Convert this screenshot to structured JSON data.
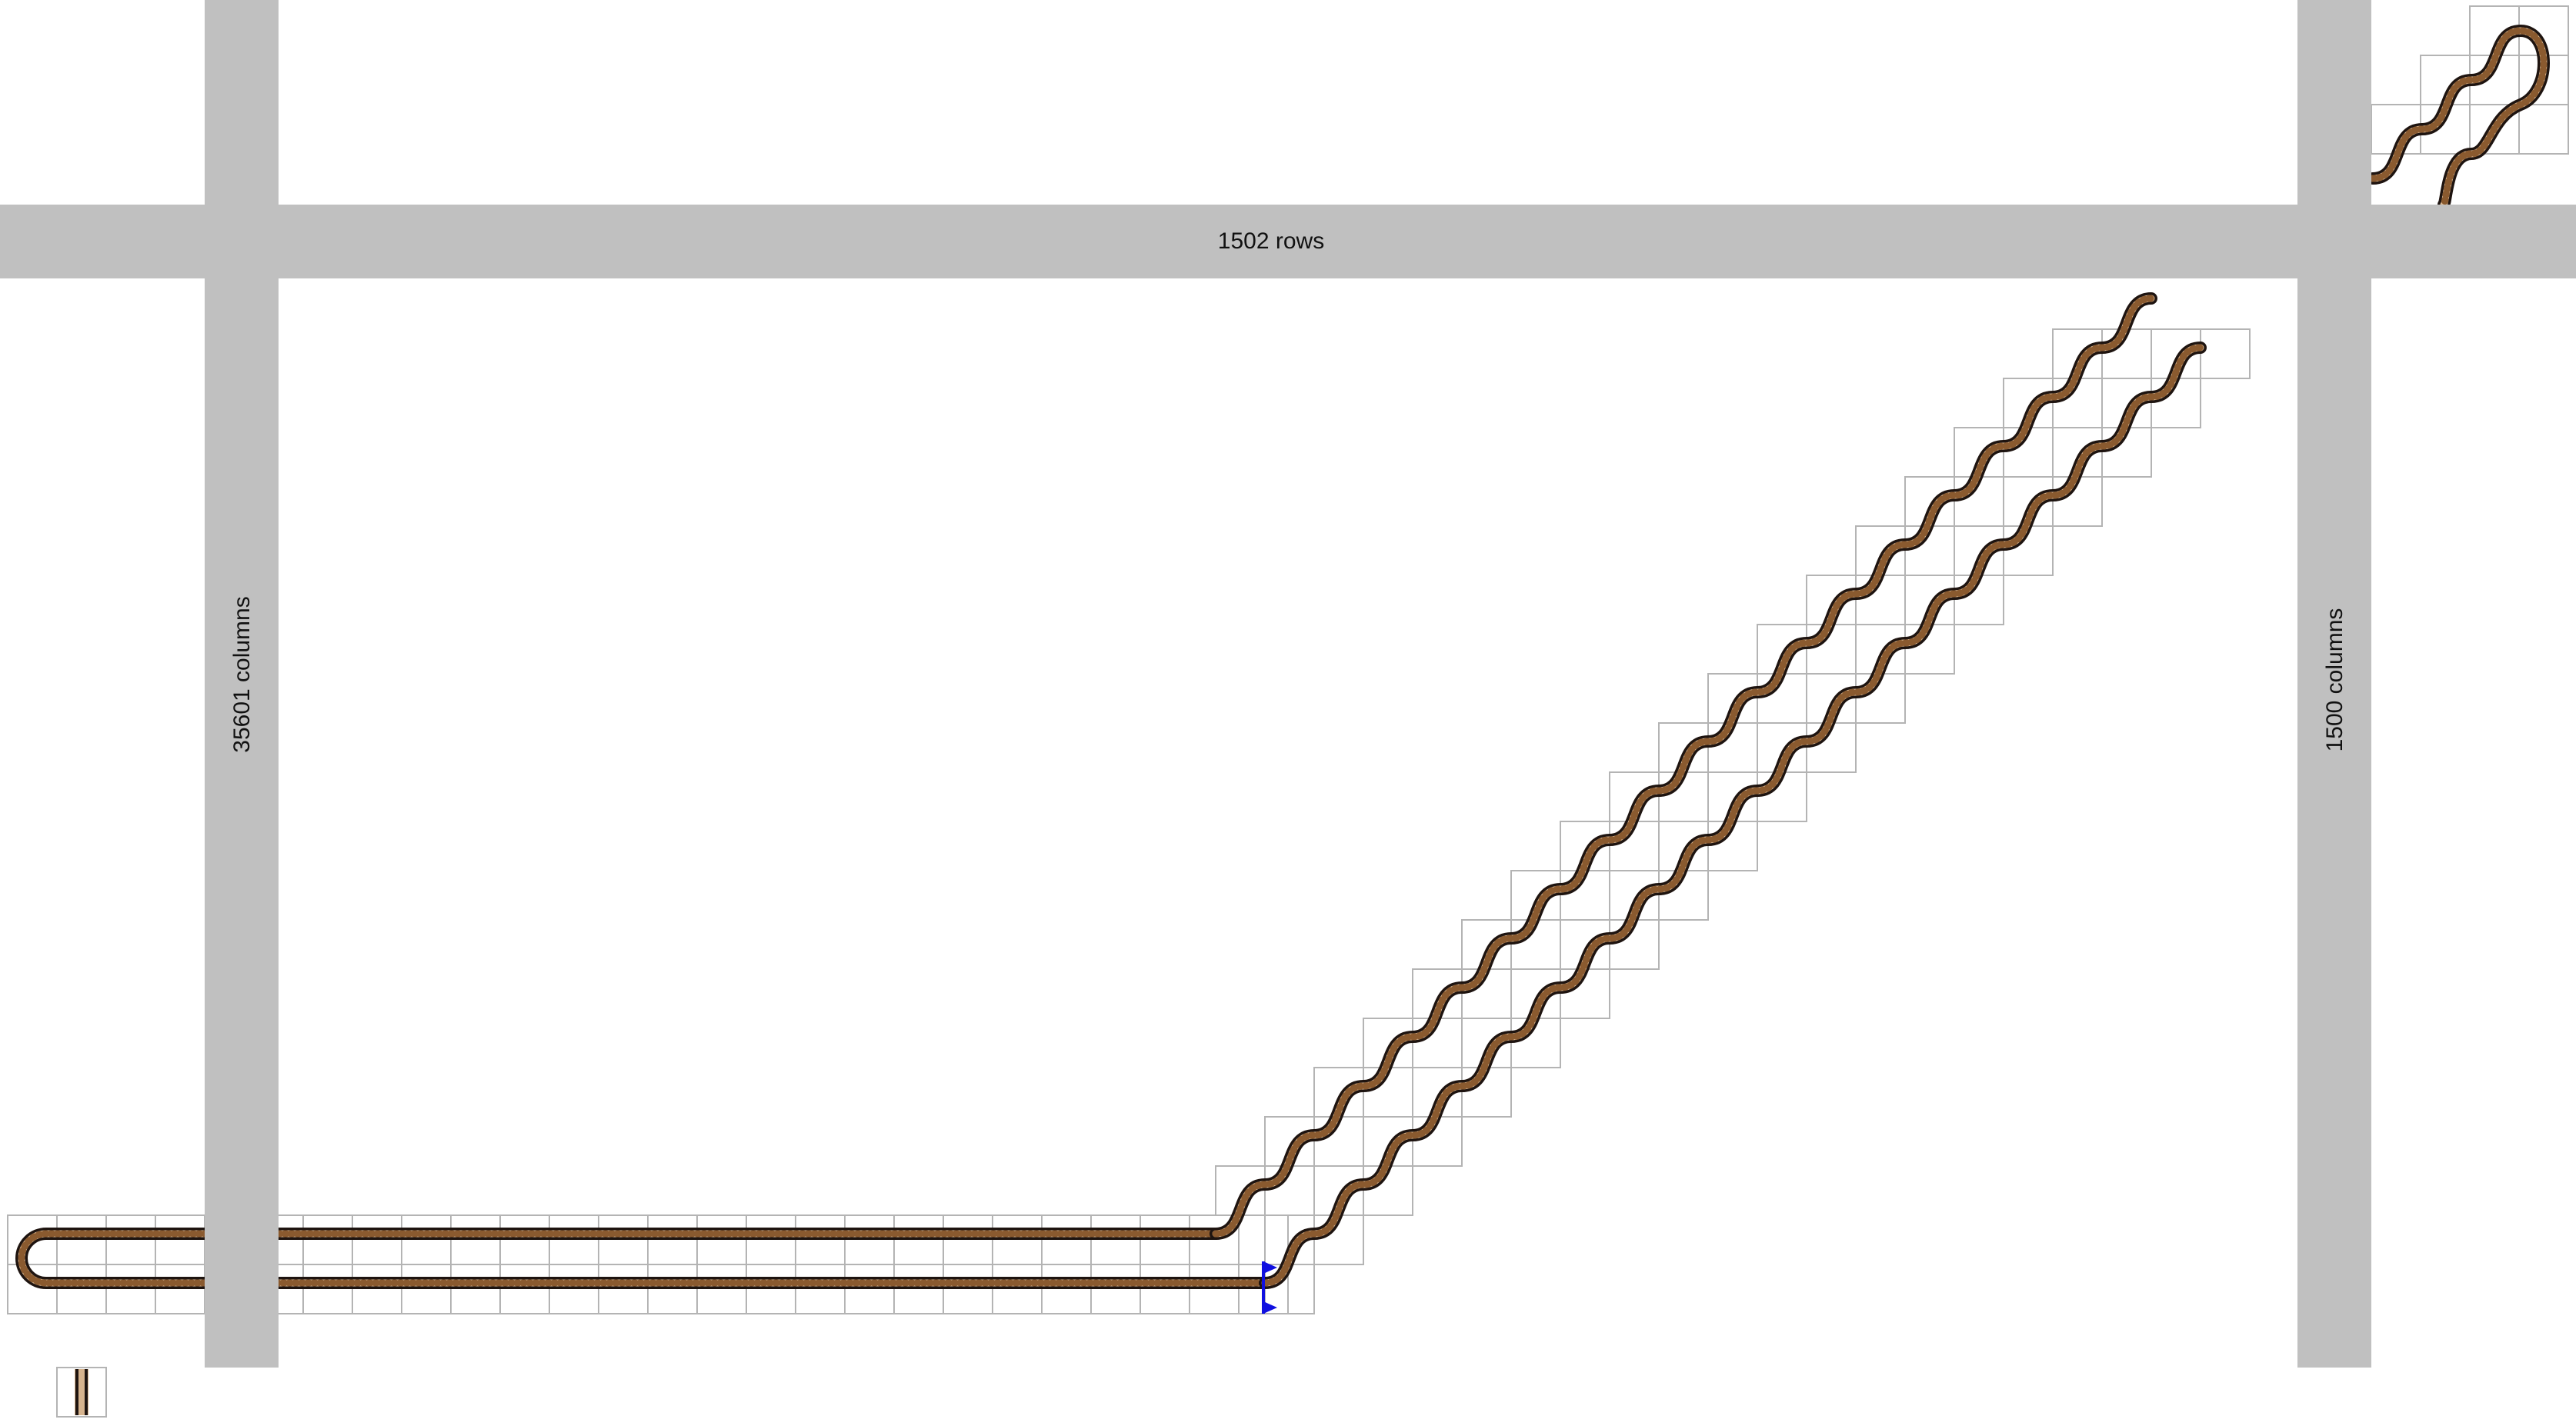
{
  "labels": {
    "rows_band": "1502 rows",
    "left_columns_band": "35601 columns",
    "right_columns_band": "1500 columns"
  },
  "colors": {
    "band": "#c0c0c0",
    "grid": "#b4b4b4",
    "rail": "#1e1410",
    "sleeper_bed": "#d7b48e",
    "sleeper_line": "#8a5a2f",
    "signal": "#1010e0",
    "background": "#ffffff"
  },
  "icons": [
    "rail-track-tile-icon",
    "signal-flag-icon"
  ]
}
